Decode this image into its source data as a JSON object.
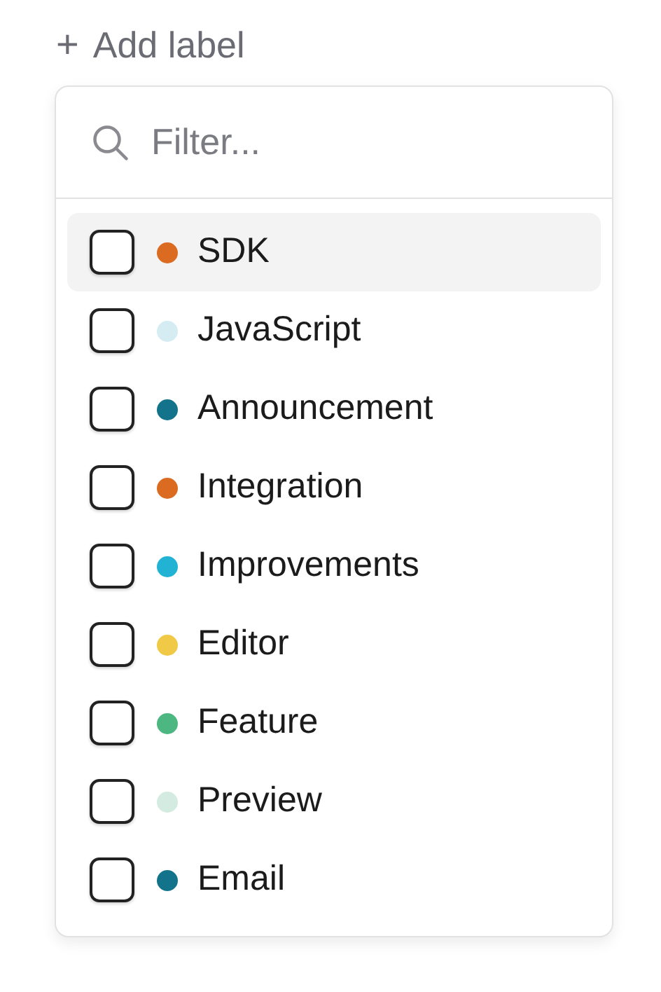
{
  "add_label": {
    "icon": "+",
    "label": "Add label"
  },
  "filter": {
    "placeholder": "Filter..."
  },
  "labels": [
    {
      "name": "SDK",
      "color": "#dc6b22",
      "checked": false,
      "selected": true
    },
    {
      "name": "JavaScript",
      "color": "#d4ecf2",
      "checked": false,
      "selected": false
    },
    {
      "name": "Announcement",
      "color": "#13738a",
      "checked": false,
      "selected": false
    },
    {
      "name": "Integration",
      "color": "#dc6b22",
      "checked": false,
      "selected": false
    },
    {
      "name": "Improvements",
      "color": "#22b3d4",
      "checked": false,
      "selected": false
    },
    {
      "name": "Editor",
      "color": "#f0c946",
      "checked": false,
      "selected": false
    },
    {
      "name": "Feature",
      "color": "#4cb780",
      "checked": false,
      "selected": false
    },
    {
      "name": "Preview",
      "color": "#d3ebe0",
      "checked": false,
      "selected": false
    },
    {
      "name": "Email",
      "color": "#13738a",
      "checked": false,
      "selected": false
    }
  ]
}
